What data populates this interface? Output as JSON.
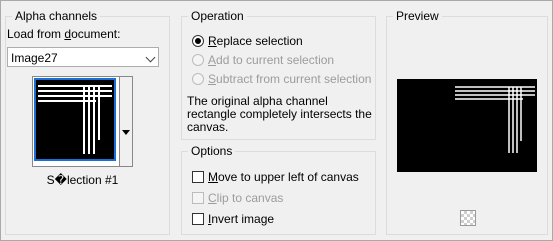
{
  "alpha_channels": {
    "title": "Alpha channels",
    "load_label_prefix": "Load from ",
    "load_label_accel": "d",
    "load_label_suffix": "ocument:",
    "document_value": "Image27",
    "selection_name": "S�lection #1"
  },
  "operation": {
    "title": "Operation",
    "options": [
      {
        "accel": "R",
        "rest": "eplace selection",
        "checked": true,
        "enabled": true
      },
      {
        "accel": "A",
        "rest": "dd to current selection",
        "checked": false,
        "enabled": false
      },
      {
        "accel": "S",
        "rest": "ubtract from current selection",
        "checked": false,
        "enabled": false
      }
    ],
    "info": "The original alpha channel rectangle completely intersects the canvas."
  },
  "options": {
    "title": "Options",
    "checks": [
      {
        "accel": "M",
        "rest": "ove to upper left of canvas",
        "checked": false,
        "enabled": true
      },
      {
        "accel": "C",
        "rest": "lip to canvas",
        "checked": false,
        "enabled": false
      },
      {
        "accel": "I",
        "rest": "nvert image",
        "checked": false,
        "enabled": true
      }
    ]
  },
  "preview": {
    "title": "Preview",
    "transparency_icon": "checkerboard-icon"
  }
}
